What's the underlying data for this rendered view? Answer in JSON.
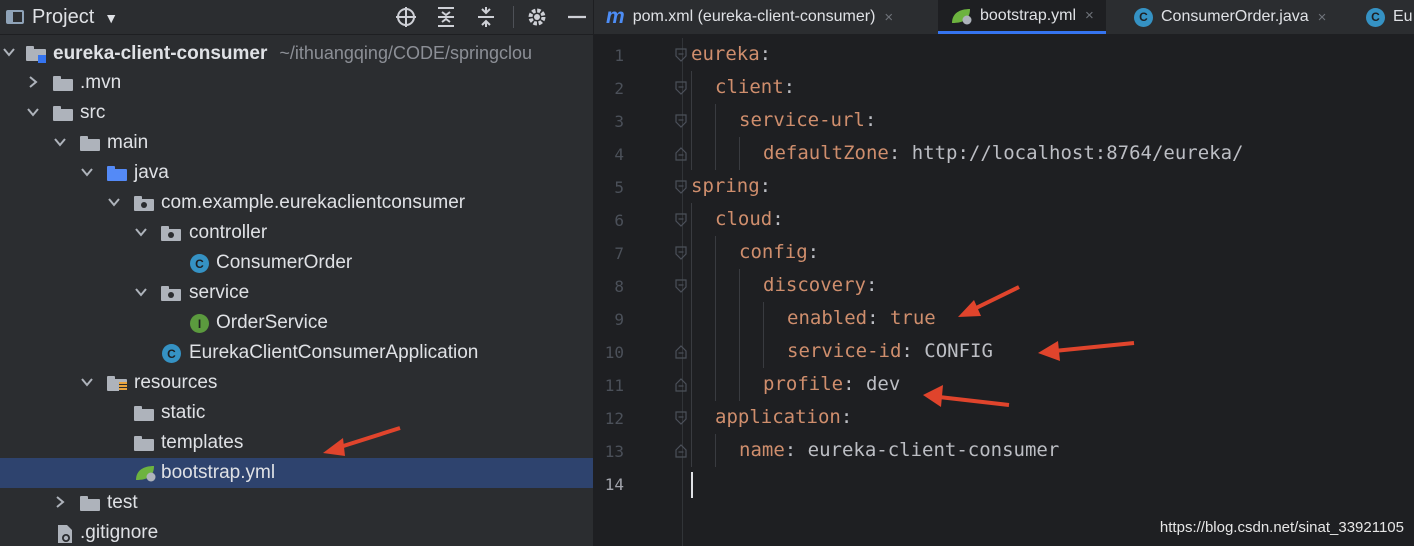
{
  "project": {
    "title": "Project",
    "tree": [
      {
        "label": "eureka-client-consumer",
        "path": "~/ithuangqing/CODE/springclou",
        "kind": "module"
      },
      {
        "label": ".mvn",
        "kind": "folder"
      },
      {
        "label": "src",
        "kind": "folder"
      },
      {
        "label": "main",
        "kind": "folder"
      },
      {
        "label": "java",
        "kind": "source-folder"
      },
      {
        "label": "com.example.eurekaclientconsumer",
        "kind": "package"
      },
      {
        "label": "controller",
        "kind": "package"
      },
      {
        "label": "ConsumerOrder",
        "kind": "class"
      },
      {
        "label": "service",
        "kind": "package"
      },
      {
        "label": "OrderService",
        "kind": "interface"
      },
      {
        "label": "EurekaClientConsumerApplication",
        "kind": "spring-boot-class"
      },
      {
        "label": "resources",
        "kind": "resources-folder"
      },
      {
        "label": "static",
        "kind": "folder"
      },
      {
        "label": "templates",
        "kind": "folder"
      },
      {
        "label": "bootstrap.yml",
        "kind": "yaml",
        "selected": true
      },
      {
        "label": "test",
        "kind": "folder"
      },
      {
        "label": ".gitignore",
        "kind": "file"
      }
    ]
  },
  "editor": {
    "tabs": [
      {
        "label": "pom.xml (eureka-client-consumer)",
        "icon": "maven-icon",
        "active": false
      },
      {
        "label": "bootstrap.yml",
        "icon": "spring-icon",
        "active": true
      },
      {
        "label": "ConsumerOrder.java",
        "icon": "class-icon",
        "active": false
      },
      {
        "label": "Eu",
        "icon": "spring-boot-icon",
        "active": false
      }
    ],
    "lines": [
      {
        "n": "1",
        "key": "eureka",
        "sep": ":",
        "val": ""
      },
      {
        "n": "2",
        "key": "client",
        "sep": ":",
        "val": ""
      },
      {
        "n": "3",
        "key": "service-url",
        "sep": ":",
        "val": ""
      },
      {
        "n": "4",
        "key": "defaultZone",
        "sep": ":",
        "val": " http://localhost:8764/eureka/"
      },
      {
        "n": "5",
        "key": "spring",
        "sep": ":",
        "val": ""
      },
      {
        "n": "6",
        "key": "cloud",
        "sep": ":",
        "val": ""
      },
      {
        "n": "7",
        "key": "config",
        "sep": ":",
        "val": ""
      },
      {
        "n": "8",
        "key": "discovery",
        "sep": ":",
        "val": ""
      },
      {
        "n": "9",
        "key": "enabled",
        "sep": ":",
        "val": " true"
      },
      {
        "n": "10",
        "key": "service-id",
        "sep": ":",
        "val": " CONFIG"
      },
      {
        "n": "11",
        "key": "profile",
        "sep": ":",
        "val": " dev"
      },
      {
        "n": "12",
        "key": "application",
        "sep": ":",
        "val": ""
      },
      {
        "n": "13",
        "key": "name",
        "sep": ":",
        "val": " eureka-client-consumer"
      },
      {
        "n": "14",
        "key": "",
        "sep": "",
        "val": ""
      }
    ]
  },
  "watermark": "https://blog.csdn.net/sinat_33921105",
  "colors": {
    "accent": "#3574f0",
    "annotation_arrow": "#e0442c",
    "yaml_key": "#cf8e6d",
    "selection": "#2e436e"
  }
}
